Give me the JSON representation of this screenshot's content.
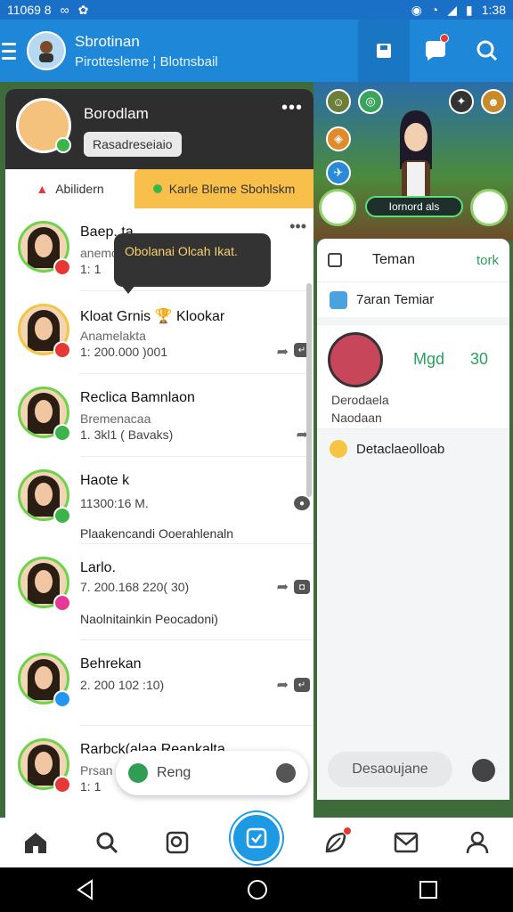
{
  "status": {
    "time": "11069 8",
    "right_time": "1:38"
  },
  "header": {
    "title": "Sbrotinan",
    "subtitle": "Pirottesleme ¦ Blotnsbail"
  },
  "profile": {
    "name": "Borodlam",
    "pill": "Rasadreseiaio",
    "more": "•••"
  },
  "tabs": {
    "left": "Abilidern",
    "right": "Karle Bleme Sbohlskm"
  },
  "tooltip": "Obolanai Olcah Ikat.",
  "chats": [
    {
      "name": "Baep. ta",
      "sub": "anemo",
      "meta": "1: 1",
      "more": "•••",
      "badge": "#e53935"
    },
    {
      "name": "Kloat Grnis",
      "name_extra": "Klookar",
      "sub": "Anamelakta",
      "meta": "1: 200.000 )001",
      "badge": "#e53935"
    },
    {
      "name": "Reclica Bamnlaon",
      "sub": "Bremenacaa",
      "meta": "1. 3kl1  ( Bavaks)",
      "badge": "#3bb54a"
    },
    {
      "name": "Haote k",
      "sub": "",
      "meta": "11300:16 M.",
      "extra": "Plaakencandi Ooerahlenaln",
      "badge": "#3bb54a"
    },
    {
      "name": "Larlo.",
      "sub": "",
      "meta": "7. 200.168 220( 30)",
      "extra": "Naolnitainkin Peocadoni)",
      "badge": "#e53995"
    },
    {
      "name": "Behrekan",
      "sub": "",
      "meta": "2. 200  102 :10)",
      "badge": "#2196f3"
    },
    {
      "name": "Rarbck(alaa Reankalta",
      "sub": "Prsan",
      "meta": "1: 1",
      "badge": "#e53935"
    }
  ],
  "search": {
    "placeholder": "Reng"
  },
  "right": {
    "title": "Teman",
    "action": "tork",
    "line1": "7aran Temiar",
    "stat1": "Mgd",
    "stat2": "30",
    "card_l1": "Derodaela",
    "card_l2": "Naodaan",
    "line2": "Detaclaeolloab",
    "search_placeholder": "Desaoujane",
    "game_tag": "Iornord als"
  },
  "colors": {
    "header": "#1e87d8",
    "accent": "#f9bf4b",
    "online": "#3bb54a"
  }
}
